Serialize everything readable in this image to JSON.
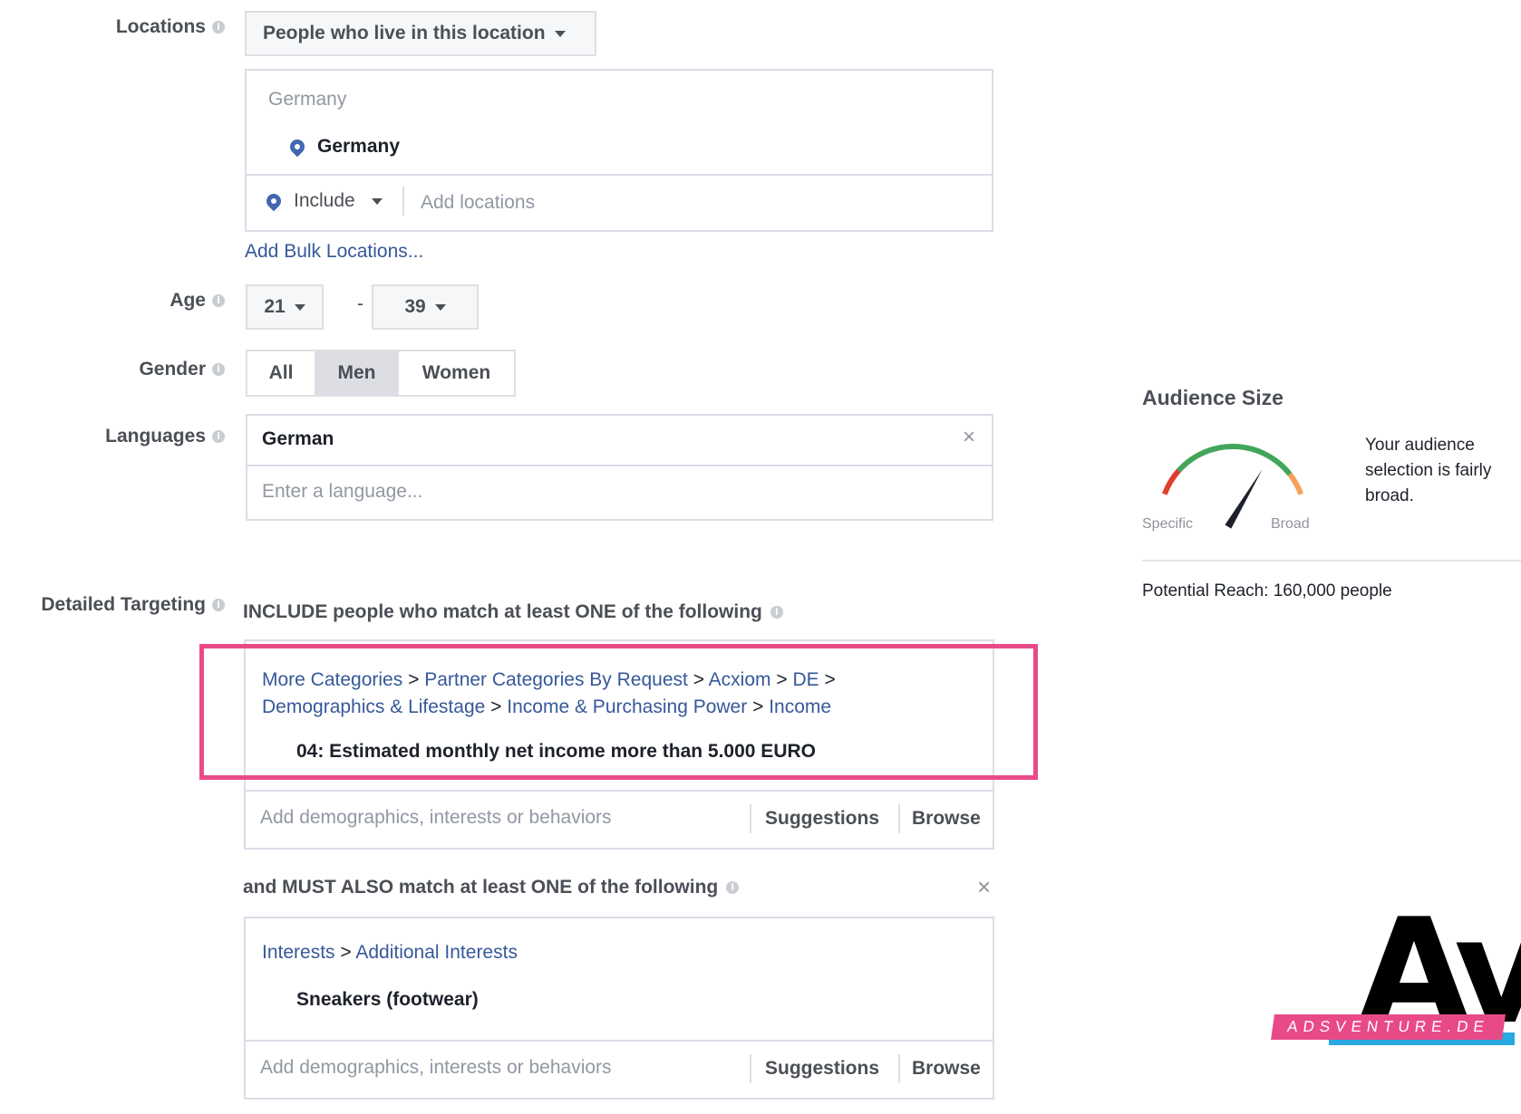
{
  "locations": {
    "label": "Locations",
    "type_select": "People who live in this location",
    "search_value": "Germany",
    "selected": "Germany",
    "include_label": "Include",
    "add_placeholder": "Add locations",
    "bulk_link": "Add Bulk Locations..."
  },
  "age": {
    "label": "Age",
    "min": "21",
    "separator": "-",
    "max": "39"
  },
  "gender": {
    "label": "Gender",
    "options": [
      "All",
      "Men",
      "Women"
    ],
    "selected": "Men"
  },
  "languages": {
    "label": "Languages",
    "selected": "German",
    "placeholder": "Enter a language..."
  },
  "detailed_targeting": {
    "label": "Detailed Targeting",
    "include_header": "INCLUDE people who match at least ONE of the following",
    "include_path": [
      "More Categories",
      "Partner Categories By Request",
      "Acxiom",
      "DE",
      "Demographics & Lifestage",
      "Income & Purchasing Power",
      "Income"
    ],
    "include_item": "04: Estimated monthly net income more than 5.000 EURO",
    "add_placeholder": "Add demographics, interests or behaviors",
    "suggestions": "Suggestions",
    "browse": "Browse",
    "narrow_header": "and MUST ALSO match at least ONE of the following",
    "narrow_path": [
      "Interests",
      "Additional Interests"
    ],
    "narrow_item": "Sneakers (footwear)"
  },
  "audience": {
    "title": "Audience Size",
    "specific": "Specific",
    "broad": "Broad",
    "message": "Your audience selection is fairly broad.",
    "potential_reach": "Potential Reach: 160,000 people",
    "level": 0.72
  },
  "logo": {
    "letters": "Av",
    "banner": "ADSVENTURE.DE"
  },
  "icons": {
    "info": "info-icon",
    "pin": "location-pin-icon",
    "close": "close-icon",
    "caret": "caret-down-icon"
  },
  "colors": {
    "link": "#365899",
    "highlight": "#e84a88",
    "gauge_green": "#42a65a",
    "gauge_red": "#e03e2d",
    "gauge_orange": "#f5a15a"
  }
}
